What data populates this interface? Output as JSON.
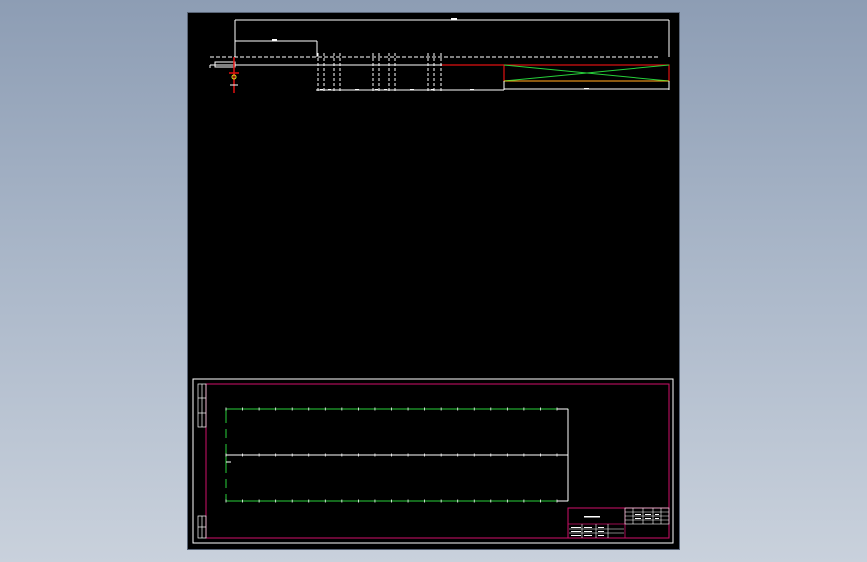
{
  "viewer": {
    "background": "#000000",
    "colors": {
      "white": "#ffffff",
      "red": "#e01010",
      "green": "#27d13a",
      "magenta": "#d0106a",
      "yellow": "#e8e020"
    }
  },
  "title_block": {
    "drawing_name": "",
    "scale": ""
  },
  "icons": {
    "elevation": "elevation-view-icon",
    "plan": "plan-view-icon"
  }
}
